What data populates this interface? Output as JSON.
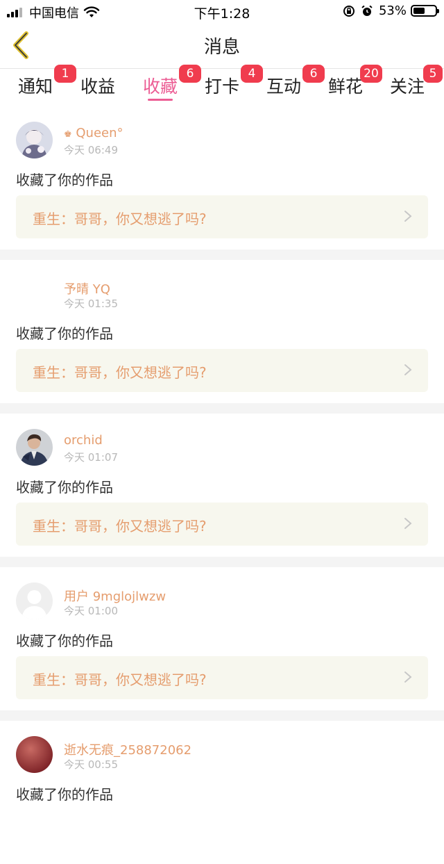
{
  "status_bar": {
    "carrier": "中国电信",
    "time": "下午1:28",
    "battery_percent": "53%",
    "battery_level": 0.53,
    "icons": [
      "signal-icon",
      "wifi-icon",
      "orientation-lock-icon",
      "alarm-icon",
      "battery-icon"
    ]
  },
  "nav": {
    "title": "消息",
    "back_icon": "chevron-left-icon"
  },
  "tabs": [
    {
      "label": "通知",
      "badge": "1"
    },
    {
      "label": "收益",
      "badge": ""
    },
    {
      "label": "收藏",
      "badge": "6",
      "active": true
    },
    {
      "label": "打卡",
      "badge": "4"
    },
    {
      "label": "互动",
      "badge": "6"
    },
    {
      "label": "鲜花",
      "badge": "20"
    },
    {
      "label": "关注",
      "badge": "5"
    }
  ],
  "feed": [
    {
      "user": "Queen°",
      "crown": "♚",
      "time": "今天 06:49",
      "action": "收藏了你的作品",
      "work": "重生：哥哥，你又想逃了吗?"
    },
    {
      "user": "予晴 YQ",
      "time": "今天 01:35",
      "action": "收藏了你的作品",
      "work": "重生：哥哥，你又想逃了吗?"
    },
    {
      "user": "orchid",
      "time": "今天 01:07",
      "action": "收藏了你的作品",
      "work": "重生：哥哥，你又想逃了吗?"
    },
    {
      "user": "用户 9mglojlwzw",
      "time": "今天 01:00",
      "action": "收藏了你的作品",
      "work": "重生：哥哥，你又想逃了吗?"
    },
    {
      "user": "逝水无痕_258872062",
      "time": "今天 00:55",
      "action": "收藏了你的作品",
      "work": ""
    }
  ],
  "colors": {
    "accent": "#ec5d94",
    "badge": "#f03c4e",
    "name": "#e59d6e",
    "work_bg": "#f7f7ee",
    "back_arrow": "#e0c231"
  }
}
